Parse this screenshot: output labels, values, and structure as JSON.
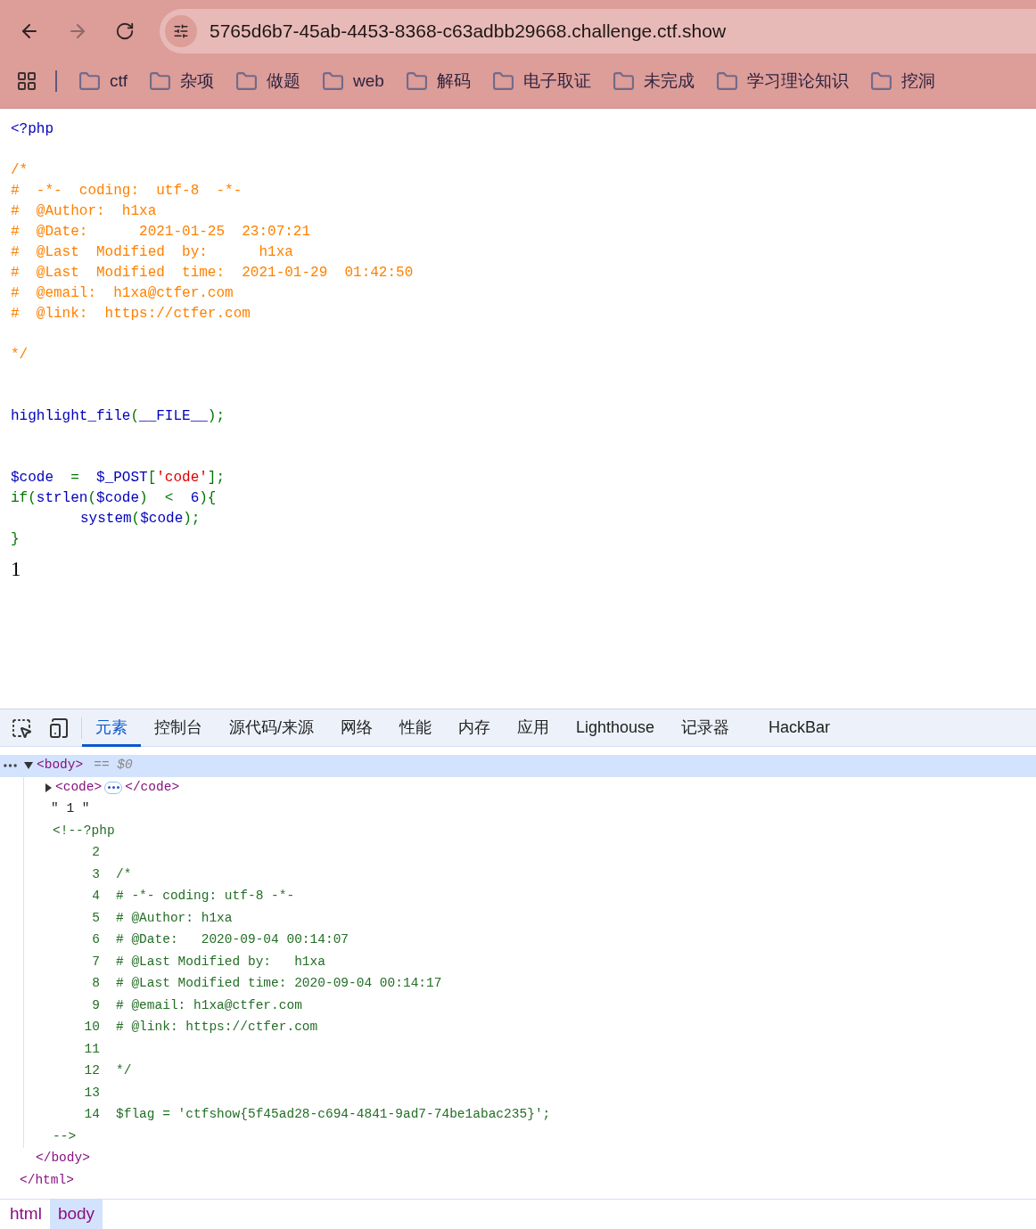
{
  "browser": {
    "url": "5765d6b7-45ab-4453-8368-c63adbb29668.challenge.ctf.show",
    "back_disabled": false,
    "forward_disabled": true,
    "bookmarks": [
      "ctf",
      "杂项",
      "做题",
      "web",
      "解码",
      "电子取证",
      "未完成",
      "学习理论知识",
      "挖洞"
    ]
  },
  "page": {
    "code_lines": [
      {
        "kind": "code",
        "tokens": [
          {
            "kind": "default",
            "text": "<?php"
          }
        ]
      },
      {
        "kind": "blank"
      },
      {
        "kind": "code",
        "tokens": [
          {
            "kind": "comment",
            "text": "/*"
          }
        ]
      },
      {
        "kind": "code",
        "tokens": [
          {
            "kind": "comment",
            "text": "#  -*-  coding:  utf-8  -*-"
          }
        ]
      },
      {
        "kind": "code",
        "tokens": [
          {
            "kind": "comment",
            "text": "#  @Author:  h1xa"
          }
        ]
      },
      {
        "kind": "code",
        "tokens": [
          {
            "kind": "comment",
            "text": "#  @Date:      2021-01-25  23:07:21"
          }
        ]
      },
      {
        "kind": "code",
        "tokens": [
          {
            "kind": "comment",
            "text": "#  @Last  Modified  by:      h1xa"
          }
        ]
      },
      {
        "kind": "code",
        "tokens": [
          {
            "kind": "comment",
            "text": "#  @Last  Modified  time:  2021-01-29  01:42:50"
          }
        ]
      },
      {
        "kind": "code",
        "tokens": [
          {
            "kind": "comment",
            "text": "#  @email:  h1xa@ctfer.com"
          }
        ]
      },
      {
        "kind": "code",
        "tokens": [
          {
            "kind": "comment",
            "text": "#  @link:  https://ctfer.com"
          }
        ]
      },
      {
        "kind": "blank"
      },
      {
        "kind": "code",
        "tokens": [
          {
            "kind": "comment",
            "text": "*/"
          }
        ]
      },
      {
        "kind": "blank"
      },
      {
        "kind": "blank"
      },
      {
        "kind": "code",
        "tokens": [
          {
            "kind": "default",
            "text": "highlight_file"
          },
          {
            "kind": "keyword",
            "text": "("
          },
          {
            "kind": "default",
            "text": "__FILE__"
          },
          {
            "kind": "keyword",
            "text": ");"
          }
        ]
      },
      {
        "kind": "blank"
      },
      {
        "kind": "blank"
      },
      {
        "kind": "code",
        "tokens": [
          {
            "kind": "default",
            "text": "$code"
          },
          {
            "kind": "keyword",
            "text": "  =  "
          },
          {
            "kind": "default",
            "text": "$_POST"
          },
          {
            "kind": "keyword",
            "text": "["
          },
          {
            "kind": "string",
            "text": "'code'"
          },
          {
            "kind": "keyword",
            "text": "];"
          }
        ]
      },
      {
        "kind": "code",
        "tokens": [
          {
            "kind": "keyword",
            "text": "if("
          },
          {
            "kind": "default",
            "text": "strlen"
          },
          {
            "kind": "keyword",
            "text": "("
          },
          {
            "kind": "default",
            "text": "$code"
          },
          {
            "kind": "keyword",
            "text": ")  <  "
          },
          {
            "kind": "default",
            "text": "6"
          },
          {
            "kind": "keyword",
            "text": "){"
          }
        ]
      },
      {
        "kind": "code",
        "indent": true,
        "tokens": [
          {
            "kind": "default",
            "text": "system"
          },
          {
            "kind": "keyword",
            "text": "("
          },
          {
            "kind": "default",
            "text": "$code"
          },
          {
            "kind": "keyword",
            "text": ");"
          }
        ]
      },
      {
        "kind": "code",
        "tokens": [
          {
            "kind": "keyword",
            "text": "}"
          }
        ]
      }
    ],
    "output": "1"
  },
  "devtools": {
    "tabs": [
      {
        "label": "元素",
        "selected": true
      },
      {
        "label": "控制台",
        "selected": false
      },
      {
        "label": "源代码/来源",
        "selected": false
      },
      {
        "label": "网络",
        "selected": false
      },
      {
        "label": "性能",
        "selected": false
      },
      {
        "label": "内存",
        "selected": false
      },
      {
        "label": "应用",
        "selected": false
      },
      {
        "label": "Lighthouse",
        "selected": false
      },
      {
        "label": "记录器",
        "selected": false
      },
      {
        "label": "HackBar",
        "selected": false
      }
    ],
    "tree": [
      {
        "kind": "element",
        "tag": "<body>",
        "suffix": "== $0",
        "expanded": true,
        "selected": true,
        "close": "</body>",
        "children": [
          {
            "kind": "element",
            "tag": "<code>",
            "close": "</code>",
            "expanded": false,
            "selected": false
          },
          {
            "kind": "text",
            "text": "\" 1 \""
          },
          {
            "kind": "comment",
            "open": "<!--?php",
            "close": "-->",
            "lines": [
              {
                "number": "2"
              },
              {
                "number": "3",
                "text": "/*"
              },
              {
                "number": "4",
                "text": "# -*- coding: utf-8 -*-"
              },
              {
                "number": "5",
                "text": "# @Author: h1xa"
              },
              {
                "number": "6",
                "text": "# @Date:   2020-09-04 00:14:07"
              },
              {
                "number": "7",
                "text": "# @Last Modified by:   h1xa"
              },
              {
                "number": "8",
                "text": "# @Last Modified time: 2020-09-04 00:14:17"
              },
              {
                "number": "9",
                "text": "# @email: h1xa@ctfer.com"
              },
              {
                "number": "10",
                "text": "# @link: https://ctfer.com"
              },
              {
                "number": "11"
              },
              {
                "number": "12",
                "text": "*/"
              },
              {
                "number": "13"
              },
              {
                "number": "14",
                "text": "$flag = 'ctfshow{5f45ad28-c694-4841-9ad7-74be1abac235}';"
              }
            ]
          }
        ]
      },
      {
        "kind": "close",
        "text": "</html>"
      }
    ],
    "breadcrumbs": [
      {
        "label": "html",
        "selected": false
      },
      {
        "label": "body",
        "selected": true
      }
    ]
  }
}
